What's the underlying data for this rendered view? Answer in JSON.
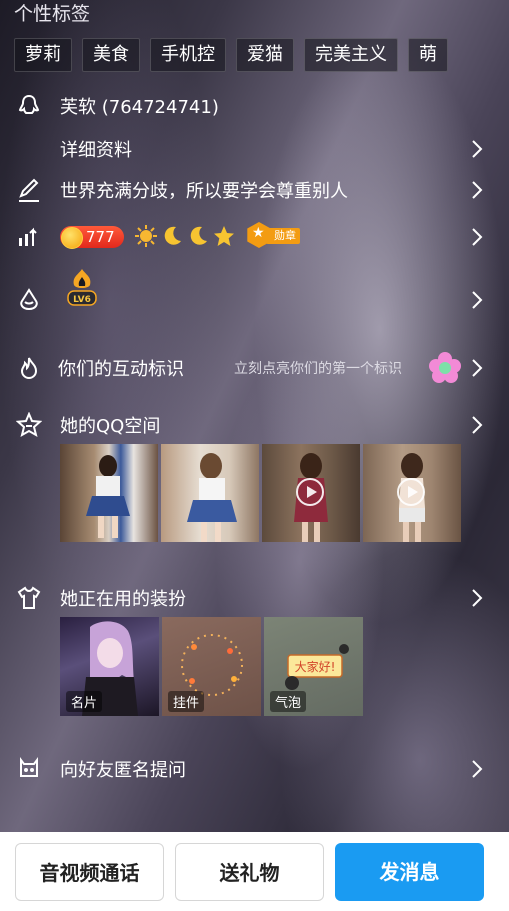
{
  "section_title": "个性标签",
  "tags": [
    "萝莉",
    "美食",
    "手机控",
    "爱猫",
    "完美主义",
    "萌"
  ],
  "profile": {
    "name_line": "芙软 (764724741)",
    "details_label": "详细资料",
    "signature": "世界充满分歧，所以要学会尊重别人"
  },
  "level": {
    "points": "777",
    "medal_label": "勋章",
    "badges": [
      "sun-icon",
      "moon-icon",
      "moon-icon",
      "star-icon"
    ]
  },
  "vip": {
    "badge_text": "LV6"
  },
  "interaction": {
    "label": "你们的互动标识",
    "hint": "立刻点亮你们的第一个标识"
  },
  "qzone": {
    "label": "她的QQ空间"
  },
  "outfit": {
    "label": "她正在用的装扮",
    "cards": [
      "名片",
      "挂件",
      "气泡"
    ],
    "bubble_text": "大家好!"
  },
  "anonymous": {
    "label": "向好友匿名提问"
  },
  "buttons": {
    "call": "音视频通话",
    "gift": "送礼物",
    "message": "发消息"
  },
  "colors": {
    "primary": "#1a9bf2",
    "badge_red": "#e2281c",
    "medal_orange": "#f39c12"
  }
}
